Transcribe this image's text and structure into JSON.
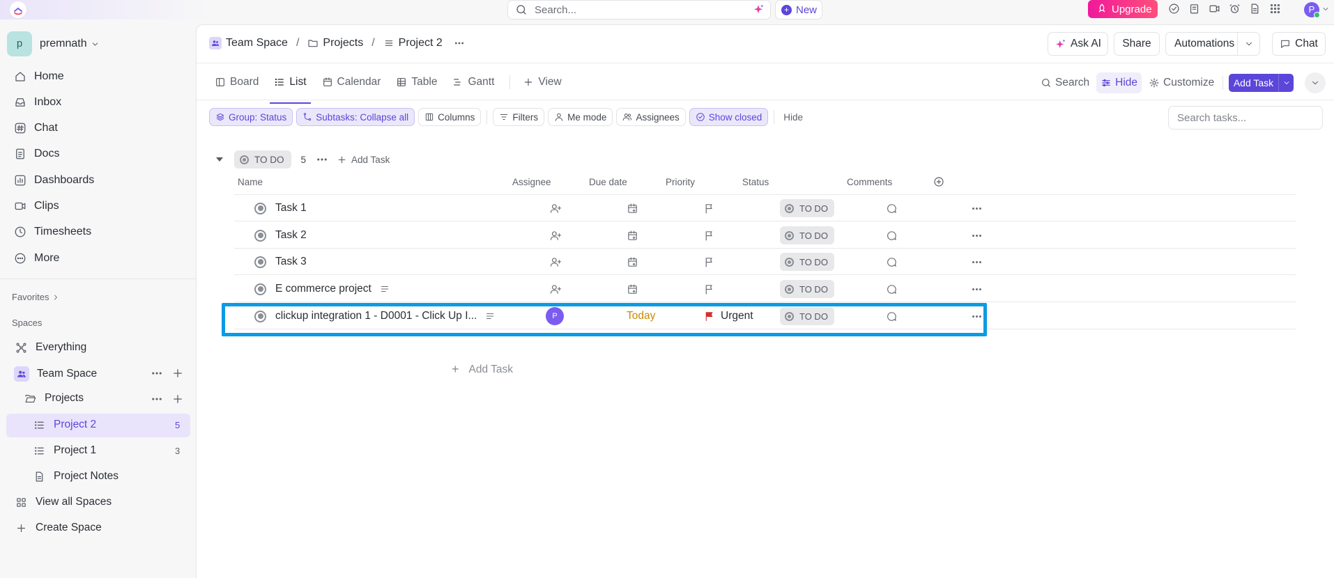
{
  "topbar": {
    "search_placeholder": "Search...",
    "new_label": "New",
    "upgrade_label": "Upgrade",
    "user_initial": "P"
  },
  "sidebar": {
    "workspace_initial": "p",
    "workspace_name": "premnath",
    "nav": [
      {
        "label": "Home",
        "icon": "home-icon"
      },
      {
        "label": "Inbox",
        "icon": "inbox-icon"
      },
      {
        "label": "Chat",
        "icon": "hash-icon"
      },
      {
        "label": "Docs",
        "icon": "doc-icon"
      },
      {
        "label": "Dashboards",
        "icon": "dashboard-icon"
      },
      {
        "label": "Clips",
        "icon": "video-icon"
      },
      {
        "label": "Timesheets",
        "icon": "clock-icon"
      },
      {
        "label": "More",
        "icon": "more-circle-icon"
      }
    ],
    "favorites_label": "Favorites",
    "spaces_label": "Spaces",
    "everything_label": "Everything",
    "team_space_label": "Team Space",
    "projects_label": "Projects",
    "project2_label": "Project 2",
    "project2_count": "5",
    "project1_label": "Project 1",
    "project1_count": "3",
    "project_notes_label": "Project Notes",
    "view_all_spaces_label": "View all Spaces",
    "create_space_label": "Create Space"
  },
  "header": {
    "crumb_space": "Team Space",
    "crumb_folder": "Projects",
    "crumb_list": "Project 2",
    "ask_ai_label": "Ask AI",
    "share_label": "Share",
    "automations_label": "Automations",
    "chat_label": "Chat"
  },
  "views": {
    "board": "Board",
    "list": "List",
    "calendar": "Calendar",
    "table": "Table",
    "gantt": "Gantt",
    "add_view": "View",
    "search": "Search",
    "hide": "Hide",
    "customize": "Customize",
    "add_task": "Add Task"
  },
  "filters": {
    "group": "Group: Status",
    "subtasks": "Subtasks: Collapse all",
    "columns": "Columns",
    "filters": "Filters",
    "me_mode": "Me mode",
    "assignees": "Assignees",
    "show_closed": "Show closed",
    "hide": "Hide",
    "search_tasks_placeholder": "Search tasks..."
  },
  "group": {
    "status": "TO DO",
    "count": "5",
    "add_task": "Add Task"
  },
  "columns": {
    "name": "Name",
    "assignee": "Assignee",
    "due_date": "Due date",
    "priority": "Priority",
    "status": "Status",
    "comments": "Comments"
  },
  "tasks": [
    {
      "name": "Task 1",
      "status": "TO DO"
    },
    {
      "name": "Task 2",
      "status": "TO DO"
    },
    {
      "name": "Task 3",
      "status": "TO DO"
    },
    {
      "name": "E commerce project",
      "status": "TO DO"
    },
    {
      "name": "clickup integration 1 - D0001 - Click Up I...",
      "status": "TO DO",
      "assignee_initial": "P",
      "due": "Today",
      "priority": "Urgent"
    }
  ],
  "add_task_row": "Add Task",
  "colors": {
    "accent": "#5b46d9",
    "highlight": "#0a9be5",
    "urgent": "#d0312d",
    "today": "#c98a06"
  }
}
